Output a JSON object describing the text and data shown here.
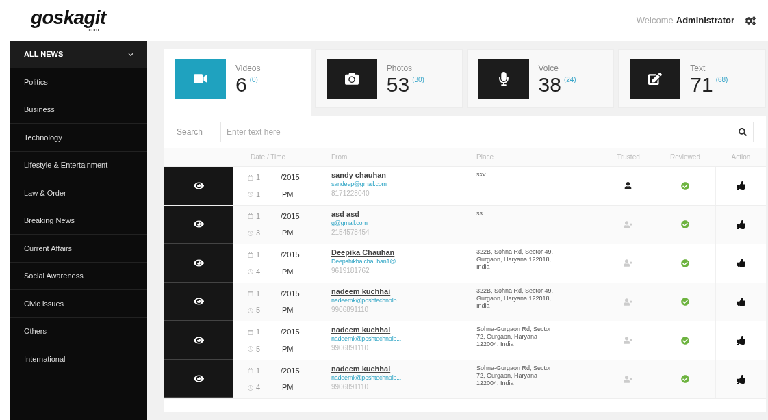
{
  "header": {
    "logo": "goskagit",
    "logo_sub": ".com",
    "welcome": "Welcome",
    "user": "Administrator"
  },
  "sidebar": {
    "header": {
      "label": "ALL NEWS",
      "expanded": true
    },
    "items": [
      "Politics",
      "Business",
      "Technology",
      "Lifestyle & Entertainment",
      "Law & Order",
      "Breaking News",
      "Current Affairs",
      "Social Awareness",
      "Civic issues",
      "Others",
      "International"
    ]
  },
  "stats": [
    {
      "kind": "video",
      "label": "Videos",
      "count": "6",
      "new": "(0)",
      "selected": true
    },
    {
      "kind": "photo",
      "label": "Photos",
      "count": "53",
      "new": "(30)",
      "selected": false
    },
    {
      "kind": "voice",
      "label": "Voice",
      "count": "38",
      "new": "(24)",
      "selected": false
    },
    {
      "kind": "text",
      "label": "Text",
      "count": "71",
      "new": "(68)",
      "selected": false
    }
  ],
  "search": {
    "label": "Search",
    "placeholder": "Enter text here"
  },
  "table": {
    "columns": [
      "Date / Time",
      "From",
      "Place",
      "Trusted",
      "Reviewed",
      "Action"
    ],
    "rows": [
      {
        "date_a": "1",
        "date_b": "/2015",
        "time_a": "1",
        "time_b": "PM",
        "name": "sandy chauhan",
        "email": "sandeep@gmail.com",
        "phone": "8171228040",
        "place": "sxv",
        "trusted": true,
        "reviewed": true
      },
      {
        "date_a": "1",
        "date_b": "/2015",
        "time_a": "3",
        "time_b": "PM",
        "name": "asd asd",
        "email": "g@gmail.com",
        "phone": "2154578454",
        "place": "ss",
        "trusted": false,
        "reviewed": true
      },
      {
        "date_a": "1",
        "date_b": "/2015",
        "time_a": "4",
        "time_b": "PM",
        "name": "Deepika Chauhan",
        "email": "Deepshikha.chauhan1@...",
        "phone": "9619181762",
        "place": "322B, Sohna Rd, Sector 49, Gurgaon, Haryana 122018, India",
        "trusted": false,
        "reviewed": true
      },
      {
        "date_a": "1",
        "date_b": "/2015",
        "time_a": "5",
        "time_b": "PM",
        "name": "nadeem kuchhai",
        "email": "nadeemk@poshtechnolo...",
        "phone": "9906891110",
        "place": "322B, Sohna Rd, Sector 49, Gurgaon, Haryana 122018, India",
        "trusted": false,
        "reviewed": true
      },
      {
        "date_a": "1",
        "date_b": "/2015",
        "time_a": "5",
        "time_b": "PM",
        "name": "nadeem kuchhai",
        "email": "nadeemk@poshtechnolo...",
        "phone": "9906891110",
        "place": "Sohna-Gurgaon Rd, Sector 72, Gurgaon, Haryana 122004, India",
        "trusted": false,
        "reviewed": true
      },
      {
        "date_a": "1",
        "date_b": "/2015",
        "time_a": "4",
        "time_b": "PM",
        "name": "nadeem kuchhai",
        "email": "nadeemk@poshtechnolo...",
        "phone": "9906891110",
        "place": "Sohna-Gurgaon Rd, Sector 72, Gurgaon, Haryana 122004, India",
        "trusted": false,
        "reviewed": true
      }
    ]
  }
}
